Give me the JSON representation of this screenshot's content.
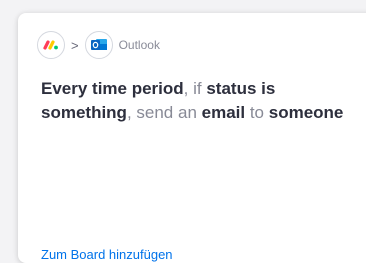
{
  "card": {
    "integration": {
      "source_icon": "monday-icon",
      "separator": ">",
      "target_icon": "outlook-icon",
      "target_name": "Outlook"
    },
    "recipe": {
      "part1": "Every time period",
      "part2": ", if ",
      "part3": "status",
      "part4": " ",
      "part5": "is something",
      "part6": ", send an ",
      "part7": "email",
      "part8": " to ",
      "part9": "someone"
    },
    "add_to_board_label": "Zum Board hinzufügen"
  },
  "colors": {
    "link": "#0073ea",
    "emphasis": "#2d2f3d",
    "muted": "#888a96",
    "monday_red": "#ff3d57",
    "monday_yellow": "#ffcb00",
    "monday_green": "#00ca72",
    "outlook_blue": "#0a64c2"
  }
}
